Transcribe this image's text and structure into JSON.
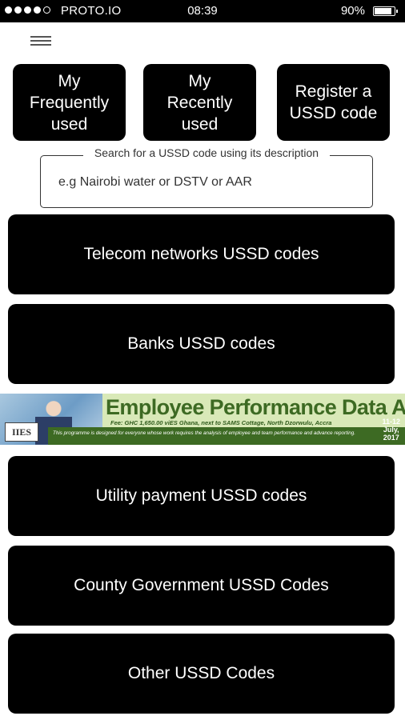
{
  "status_bar": {
    "carrier": "PROTO.IO",
    "time": "08:39",
    "battery_text": "90%",
    "battery_level": 0.9,
    "signal_dots_filled": 4,
    "signal_dots_total": 5
  },
  "menu": {
    "icon": "hamburger-menu-icon"
  },
  "top_buttons": {
    "frequently_used": "My\nFrequently\nused",
    "recently_used": "My\nRecently\nused",
    "register": "Register a\nUSSD code"
  },
  "search": {
    "legend": "Search for a USSD code using its description",
    "placeholder": "e.g Nairobi water or DSTV or AAR",
    "value": ""
  },
  "categories": {
    "telecom": "Telecom networks USSD codes",
    "banks": "Banks USSD codes",
    "utility": "Utility payment USSD codes",
    "county": "County Government USSD Codes",
    "other": "Other USSD Codes"
  },
  "banner": {
    "logo_text": "IIES",
    "title": "Employee Performance Data Analyst",
    "fee_line": "Fee: GHC 1,650.00     viES Ghana, next to SAMS Cottage, North Dzorwulu, Accra",
    "description": "This programme is designed for everyone whose work requires the analysis of employee and team performance and advance reporting.",
    "date": "11-12\nJuly,\n2017"
  },
  "colors": {
    "button_bg": "#000000",
    "button_text": "#ffffff",
    "banner_green": "#3d6a23"
  }
}
